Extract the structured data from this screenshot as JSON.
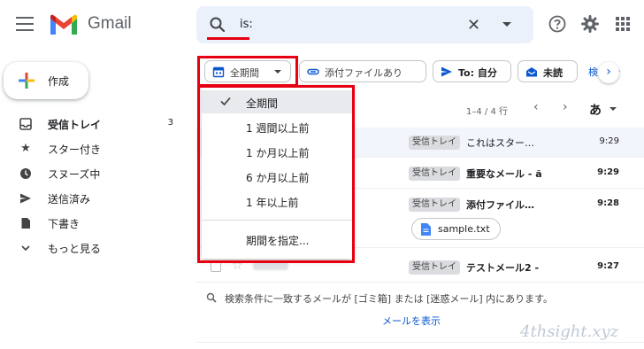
{
  "app": {
    "name": "Gmail",
    "colors": {
      "red": "#EA4335",
      "blue": "#4285F4",
      "green": "#34A853",
      "yellow": "#FBBC04",
      "highlight": "#E60012"
    }
  },
  "search": {
    "query": "is:"
  },
  "header_icons": [
    "help-icon",
    "settings-icon",
    "apps-icon"
  ],
  "compose": {
    "label": "作成"
  },
  "sidebar": {
    "items": [
      {
        "label": "受信トレイ",
        "count": "3",
        "icon": "inbox-icon"
      },
      {
        "label": "スター付き",
        "icon": "star-icon"
      },
      {
        "label": "スヌーズ中",
        "icon": "clock-icon"
      },
      {
        "label": "送信済み",
        "icon": "send-icon"
      },
      {
        "label": "下書き",
        "icon": "draft-icon"
      },
      {
        "label": "もっと見る",
        "icon": "chevron-down-icon"
      }
    ]
  },
  "chips": [
    {
      "label": "全期間",
      "icon": "calendar-icon"
    },
    {
      "label": "添付ファイルあり",
      "icon": "attachment-icon"
    },
    {
      "label": "To: 自分",
      "icon": "send-icon"
    },
    {
      "label": "未読",
      "icon": "unread-icon"
    }
  ],
  "chip_cut_label": "検 ブシ",
  "list": {
    "pager": "1–4 / 4 行",
    "sort": "あ"
  },
  "rows": [
    {
      "tag": "受信トレイ",
      "subject": "これはスター…",
      "time": "9:29",
      "unread": false
    },
    {
      "tag": "受信トレイ",
      "subject": "重要なメール - ã",
      "time": "9:29",
      "unread": true
    },
    {
      "tag": "受信トレイ",
      "subject": "添付ファイル…",
      "time": "9:28",
      "unread": true
    },
    {
      "tag": "受信トレイ",
      "subject": "テストメール2 -",
      "time": "9:27",
      "unread": true
    }
  ],
  "attachment": {
    "label": "sample.txt"
  },
  "dropdown": {
    "items": [
      {
        "label": "全期間",
        "selected": true
      },
      {
        "label": "1 週間以上前"
      },
      {
        "label": "1 か月以上前"
      },
      {
        "label": "6 か月以上前"
      },
      {
        "label": "1 年以上前"
      }
    ],
    "custom": "期間を指定..."
  },
  "notice": {
    "text": "検索条件に一致するメールが [ゴミ箱] または [迷惑メール] 内にあります。",
    "link": "メールを表示"
  },
  "watermark": "4thsight.xyz"
}
